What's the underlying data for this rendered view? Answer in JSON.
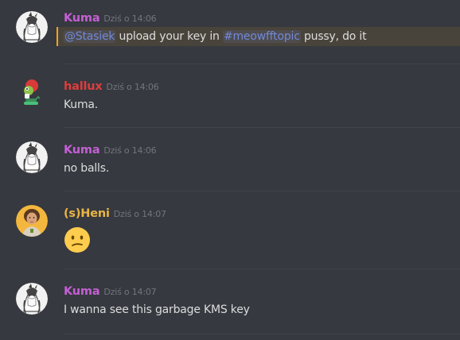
{
  "messages": [
    {
      "author": "Kuma",
      "author_color": "#c55fd6",
      "timestamp": "Dziś o 14:06",
      "mention_user": "@Stasiek",
      "text_mid": " upload your key in ",
      "mention_channel": "#meowfftopic",
      "text_end": " pussy, do it",
      "avatar_icon": "anime-girl-avatar-icon"
    },
    {
      "author": "hallux",
      "author_color": "#e03c3c",
      "timestamp": "Dziś o 14:06",
      "text": "Kuma.",
      "avatar_icon": "frog-character-avatar-icon"
    },
    {
      "author": "Kuma",
      "author_color": "#c55fd6",
      "timestamp": "Dziś o 14:06",
      "text": "no balls.",
      "avatar_icon": "anime-girl-avatar-icon"
    },
    {
      "author": "(s)Heni",
      "author_color": "#e9b545",
      "timestamp": "Dziś o 14:07",
      "emoji": "confused-face-emoji",
      "avatar_icon": "person-photo-avatar-icon"
    },
    {
      "author": "Kuma",
      "author_color": "#c55fd6",
      "timestamp": "Dziś o 14:07",
      "text": "I wanna see this garbage KMS key",
      "avatar_icon": "anime-girl-avatar-icon"
    }
  ]
}
